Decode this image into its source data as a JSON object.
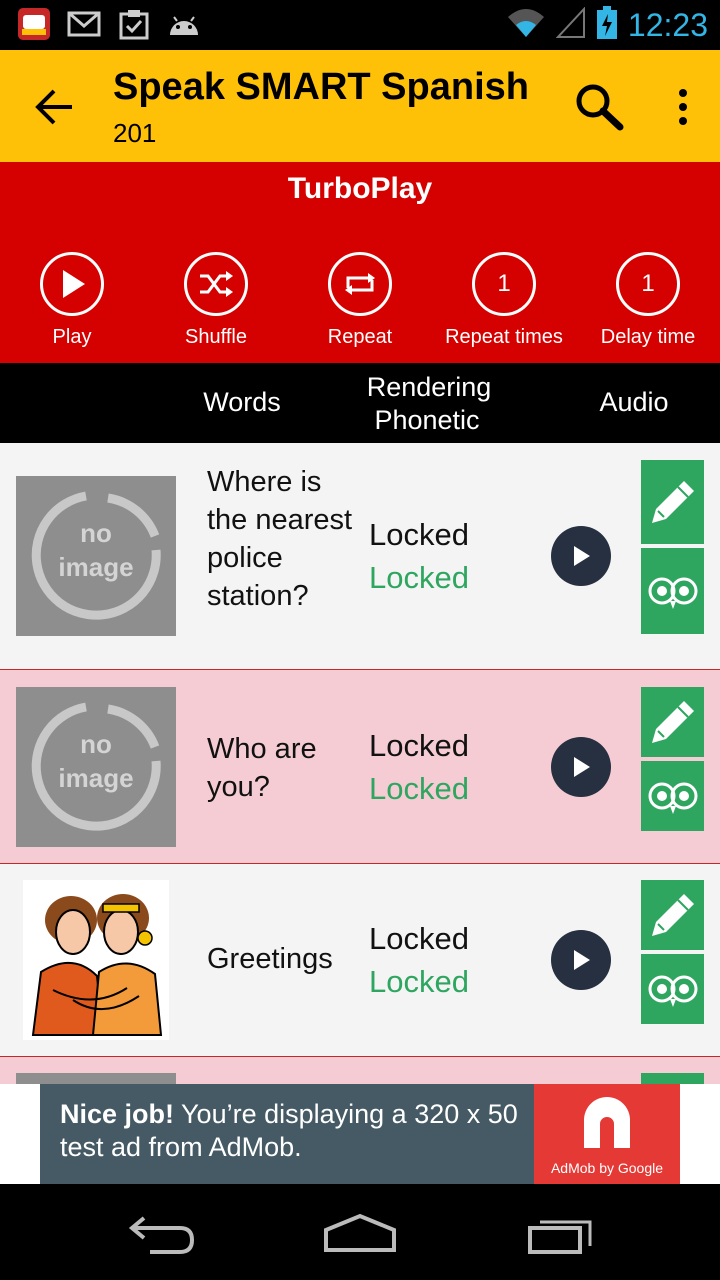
{
  "status_bar": {
    "time": "12:23",
    "icons": [
      "app-notification-icon",
      "gmail-icon",
      "clipboard-check-icon",
      "android-icon",
      "wifi-icon",
      "signal-icon",
      "battery-charging-icon"
    ]
  },
  "toolbar": {
    "title": "Speak SMART Spanish",
    "subtitle": "201",
    "color": "#ffc107"
  },
  "turboplay": {
    "title": "TurboPlay",
    "color": "#d50000",
    "controls": [
      {
        "label": "Play",
        "icon": "play-icon"
      },
      {
        "label": "Shuffle",
        "icon": "shuffle-icon"
      },
      {
        "label": "Repeat",
        "icon": "repeat-icon"
      },
      {
        "label": "Repeat times",
        "value": "1"
      },
      {
        "label": "Delay time",
        "value": "1"
      }
    ]
  },
  "columns": {
    "words": "Words",
    "rendering": "Rendering",
    "phonetic": "Phonetic",
    "audio": "Audio"
  },
  "rows": [
    {
      "word": "Where is the nearest police station?",
      "rendering": "Locked",
      "phonetic": "Locked",
      "image": "no image"
    },
    {
      "word": "Who are you?",
      "rendering": "Locked",
      "phonetic": "Locked",
      "image": "no image"
    },
    {
      "word": "Greetings",
      "rendering": "Locked",
      "phonetic": "Locked",
      "image": "greeting-illustration"
    }
  ],
  "placeholder": {
    "line1": "no",
    "line2": "image"
  },
  "ad": {
    "bold": "Nice job!",
    "text": " You’re displaying a 320 x 50 test ad from AdMob.",
    "brand": "AdMob by Google"
  },
  "colors": {
    "green": "#2ea660",
    "row_pink": "#f5ccd3",
    "row_light": "#f4f4f4",
    "play_dark": "#263040"
  }
}
